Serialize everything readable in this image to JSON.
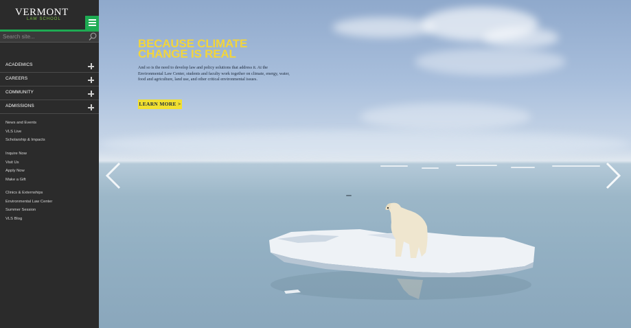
{
  "brand": {
    "name": "VERMONT",
    "subtitle": "LAW SCHOOL",
    "green": "#1eab53",
    "accent_yellow": "#f2e030"
  },
  "header": {
    "menu_icon": "hamburger-icon"
  },
  "search": {
    "placeholder": "Search site...",
    "icon": "search-icon"
  },
  "nav": {
    "items": [
      {
        "label": "ACADEMICS",
        "icon": "plus-icon"
      },
      {
        "label": "CAREERS",
        "icon": "plus-icon"
      },
      {
        "label": "COMMUNITY",
        "icon": "plus-icon"
      },
      {
        "label": "ADMISSIONS",
        "icon": "plus-icon"
      }
    ]
  },
  "links": {
    "group1": [
      "News and Events",
      "VLS Live",
      "Scholarship & Impacts"
    ],
    "group2": [
      "Inquire Now",
      "Visit Us",
      "Apply Now",
      "Make a Gift"
    ],
    "group3": [
      "Clinics & Externships",
      "Environmental Law Center",
      "Summer Session",
      "VLS Blog"
    ]
  },
  "hero": {
    "title": "BECAUSE CLIMATE CHANGE IS REAL",
    "body": "And so is the need to develop law and policy solutions that address it. At the Environmental Law Center, students and faculty work together on climate, energy, water, food and agriculture, land use, and other critical environmental issues.",
    "cta": "LEARN MORE >",
    "prev_icon": "chevron-left-icon",
    "next_icon": "chevron-right-icon",
    "title_color": "#f2d53c"
  }
}
